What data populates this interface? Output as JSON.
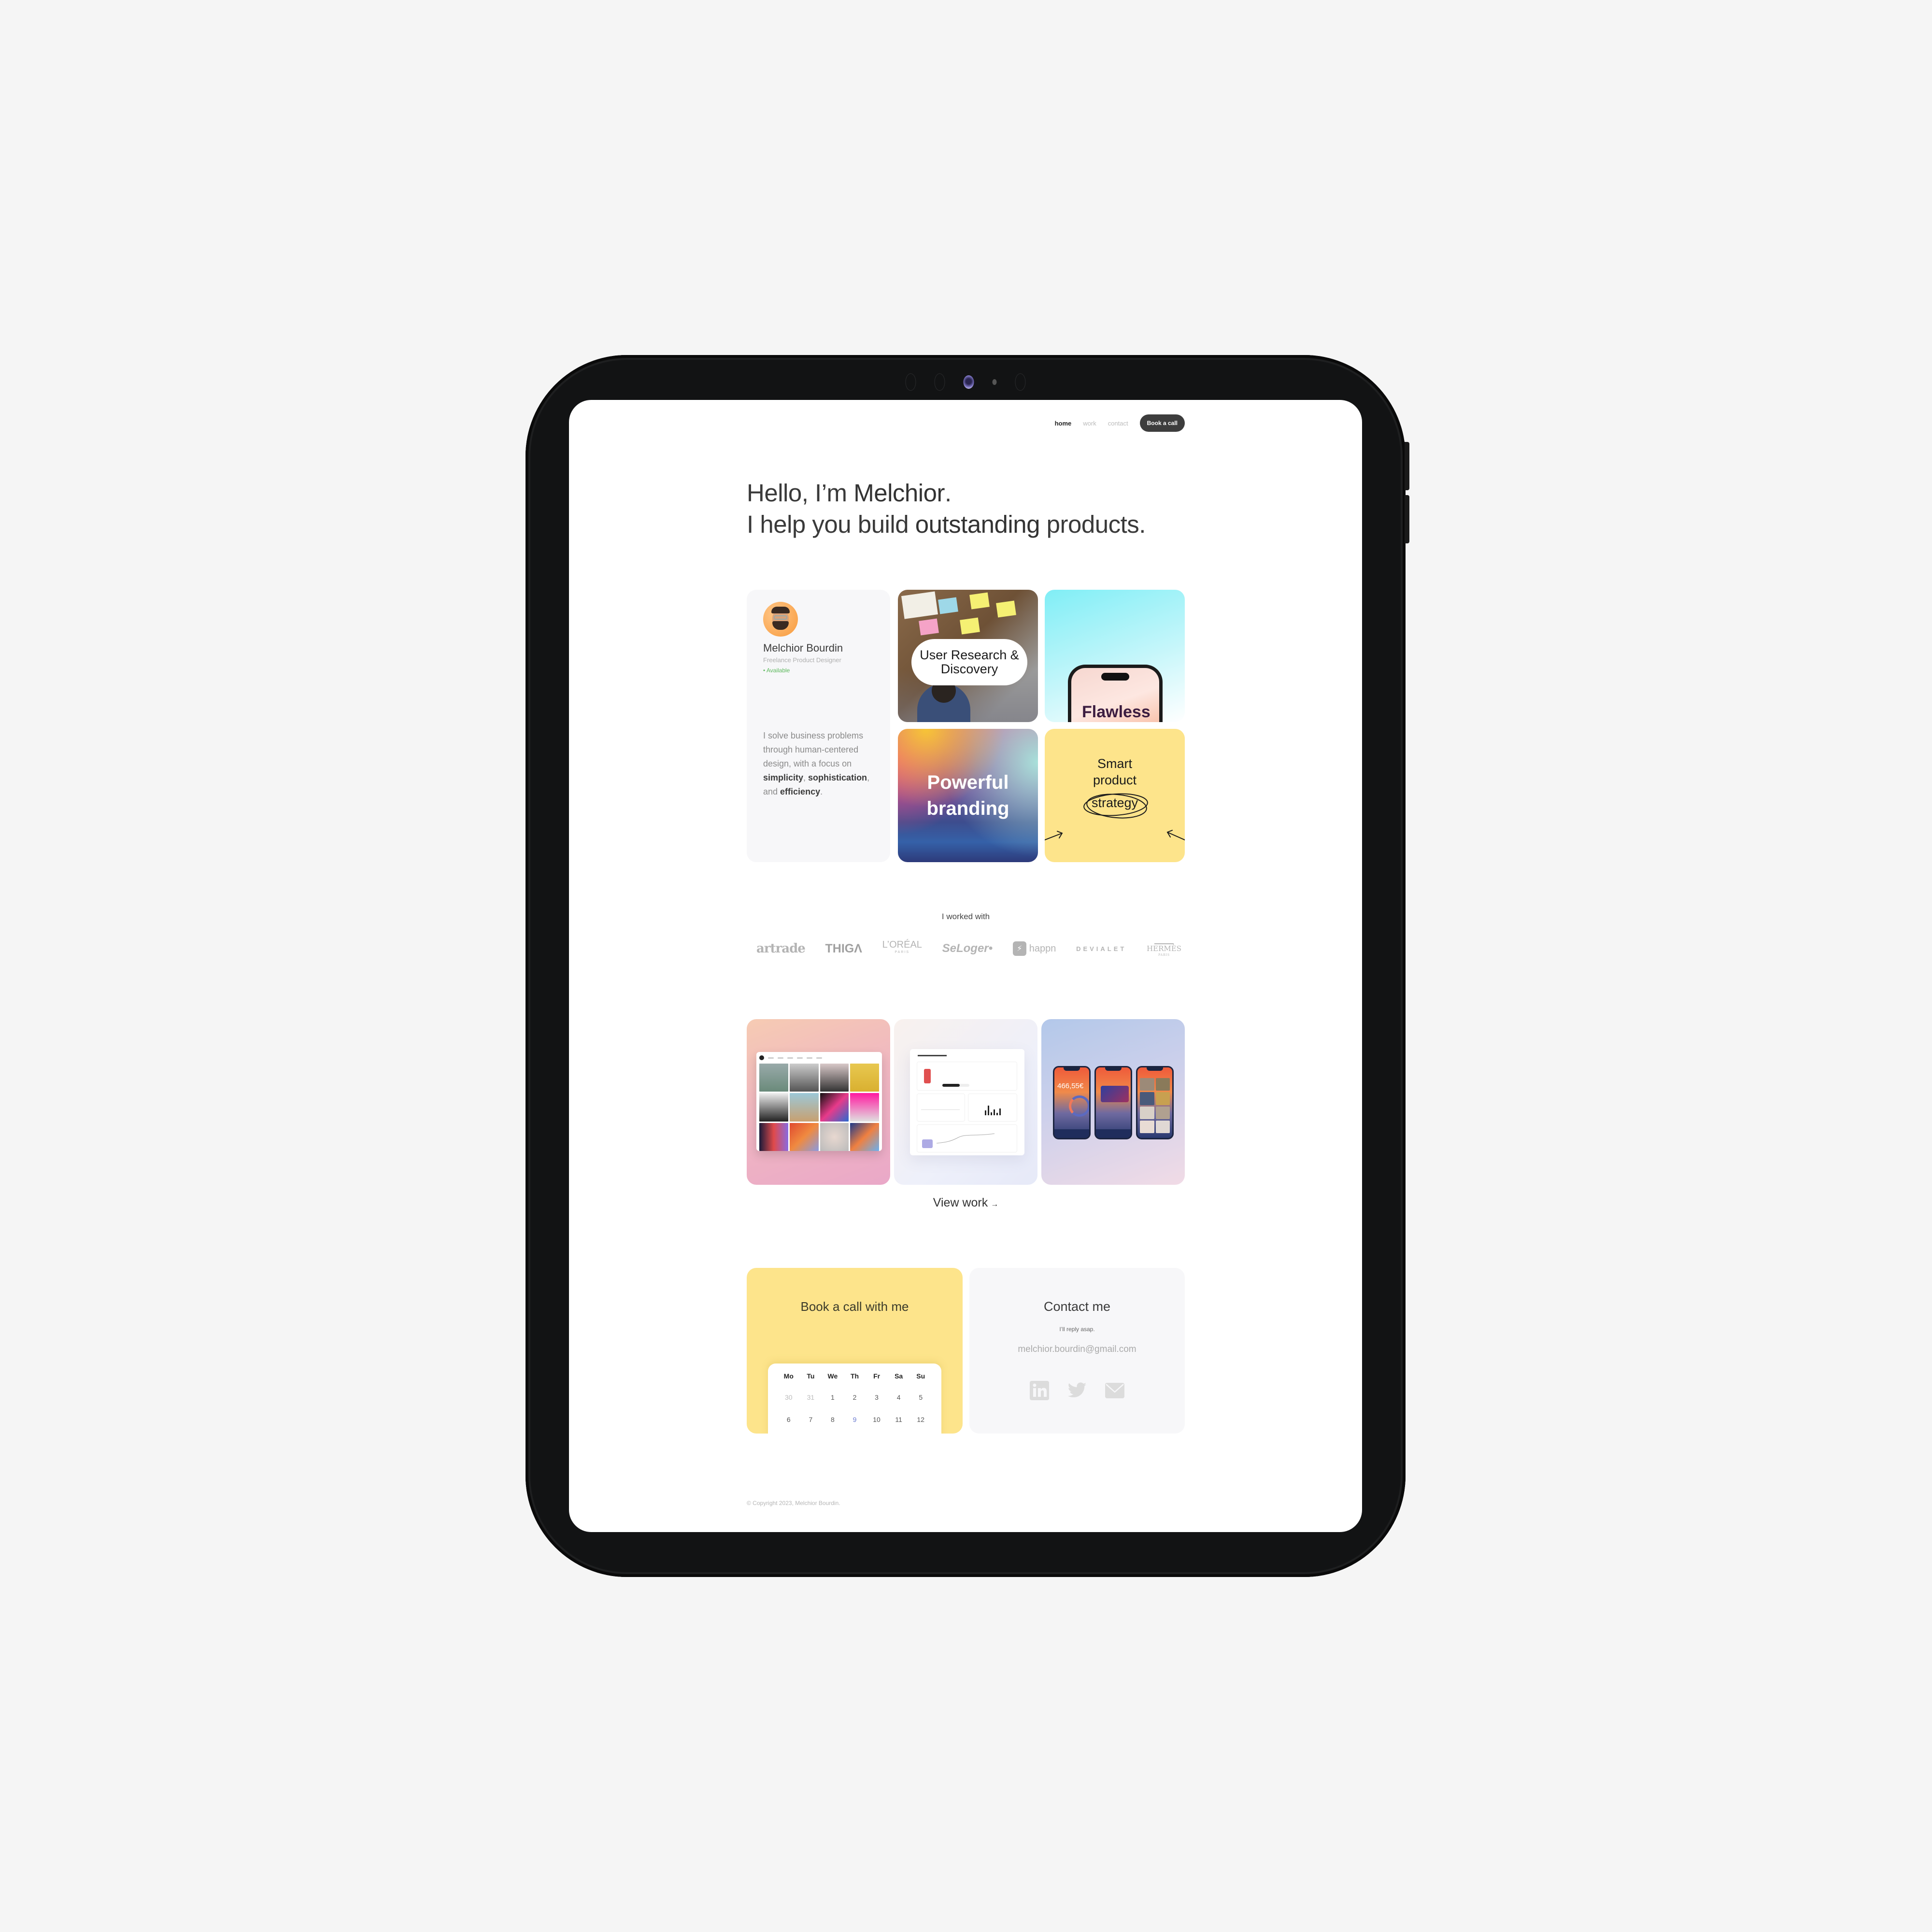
{
  "nav": {
    "items": [
      {
        "label": "home",
        "active": true
      },
      {
        "label": "work",
        "active": false
      },
      {
        "label": "contact",
        "active": false
      }
    ],
    "cta_label": "Book a call"
  },
  "hero": {
    "line1_prefix": "Hello, I’m ",
    "line1_name": "Melchior",
    "line1_suffix": ".",
    "line2_prefix": "I help you build ",
    "line2_emphasis": "outstanding",
    "line2_suffix": " products."
  },
  "profile": {
    "name": "Melchior Bourdin",
    "role": "Freelance Product Designer",
    "status": "• Available",
    "status_color": "#5cb85c",
    "bio_parts": {
      "intro": "I solve business problems through human-centered design, with a focus on ",
      "k1": "simplicity",
      "sep1": ", ",
      "k2": "sophistication",
      "sep2": ", and ",
      "k3": "efficiency",
      "end": "."
    }
  },
  "tiles": {
    "research": "User Research & Discovery",
    "flawless": "Flawless",
    "branding": "Powerful branding",
    "strategy_line1": "Smart",
    "strategy_line2": "product",
    "strategy_word": "strategy"
  },
  "clients": {
    "title": "I worked with",
    "logos": [
      {
        "name": "artrade",
        "text": "artrade"
      },
      {
        "name": "thiga",
        "text": "THIGΛ"
      },
      {
        "name": "loreal",
        "text": "L’ORÉAL",
        "sub": "PARIS"
      },
      {
        "name": "seloger",
        "text": "SeLoger•"
      },
      {
        "name": "happn",
        "text": "happn"
      },
      {
        "name": "devialet",
        "text": "DEVIALET"
      },
      {
        "name": "hermes",
        "text": "HERMÈS",
        "sub": "PARIS"
      }
    ]
  },
  "work": {
    "cards": [
      {
        "name": "gallery-web-app"
      },
      {
        "name": "dashboard-web-app"
      },
      {
        "name": "banking-mobile-app",
        "phone_amount": "466,55€"
      }
    ],
    "view_label": "View work",
    "view_arrow": "→"
  },
  "book_call": {
    "title": "Book a call with me",
    "weekdays": [
      "Mo",
      "Tu",
      "We",
      "Th",
      "Fr",
      "Sa",
      "Su"
    ],
    "week1": [
      "30",
      "31",
      "1",
      "2",
      "3",
      "4",
      "5"
    ],
    "week2": [
      "6",
      "7",
      "8",
      "9",
      "10",
      "11",
      "12"
    ],
    "highlighted_day": "9"
  },
  "contact": {
    "title": "Contact me",
    "subtitle": "I’ll reply asap.",
    "email": "melchior.bourdin@gmail.com",
    "socials": [
      "linkedin-icon",
      "twitter-icon",
      "mail-icon"
    ]
  },
  "footer": {
    "copyright": "© Copyright 2023, Melchior Bourdin."
  },
  "colors": {
    "accent_yellow": "#fde48b",
    "nav_button": "#3d3d3d",
    "card_grey": "#f7f7f9"
  }
}
